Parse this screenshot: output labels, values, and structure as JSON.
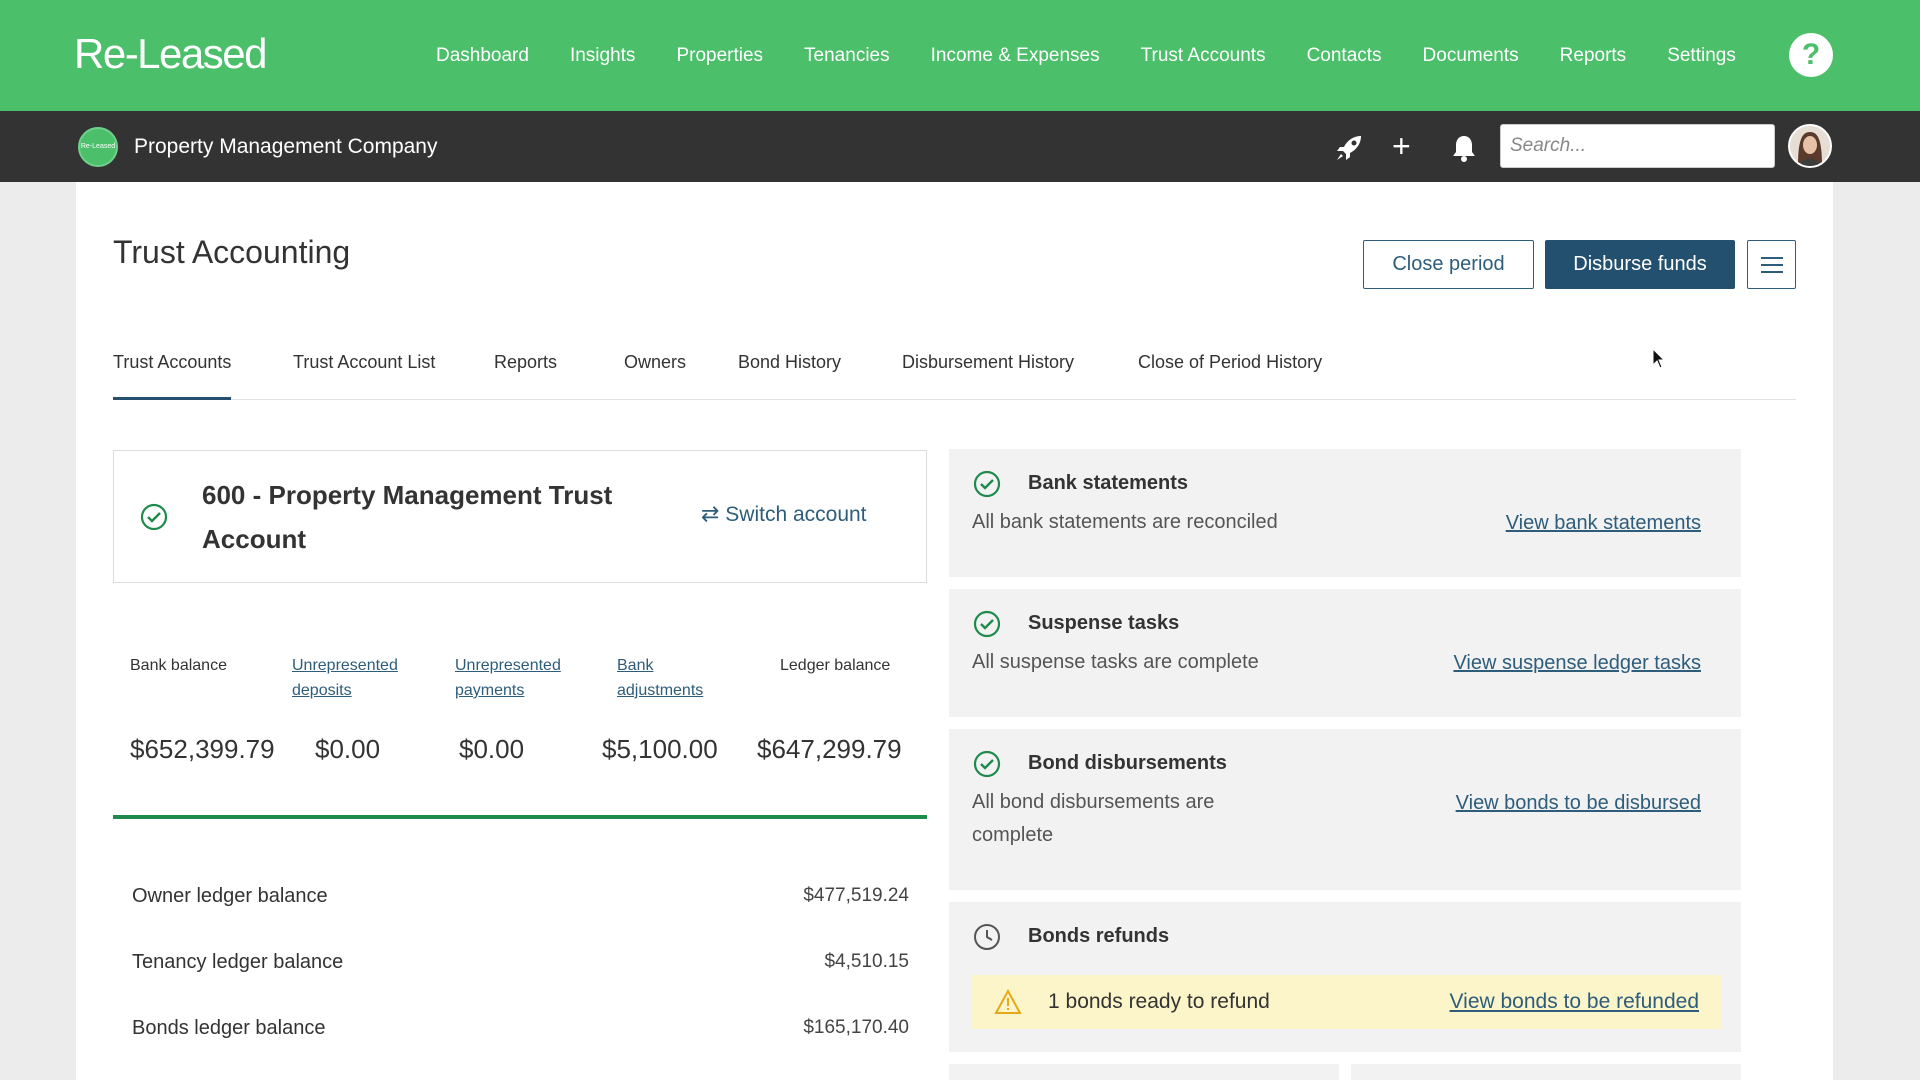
{
  "app": {
    "logo": "Re-Leased",
    "nav": [
      "Dashboard",
      "Insights",
      "Properties",
      "Tenancies",
      "Income & Expenses",
      "Trust Accounts",
      "Contacts",
      "Documents",
      "Reports",
      "Settings"
    ],
    "help": "?"
  },
  "subbar": {
    "company_logo_text": "Re-Leased",
    "company_name": "Property Management Company",
    "search_placeholder": "Search..."
  },
  "page": {
    "title": "Trust Accounting",
    "close_period_label": "Close period",
    "disburse_label": "Disburse funds",
    "tabs": [
      "Trust Accounts",
      "Trust Account List",
      "Reports",
      "Owners",
      "Bond History",
      "Disbursement History",
      "Close of Period History"
    ],
    "active_tab": "Trust Accounts"
  },
  "account": {
    "name": "600 - Property Management Trust Account",
    "switch_label": "Switch account",
    "balances": [
      {
        "label": "Bank balance",
        "value": "$652,399.79",
        "link": false
      },
      {
        "label": "Unrepresented deposits",
        "value": "$0.00",
        "link": true
      },
      {
        "label": "Unrepresented payments",
        "value": "$0.00",
        "link": true
      },
      {
        "label": "Bank adjustments",
        "value": "$5,100.00",
        "link": true
      },
      {
        "label": "Ledger balance",
        "value": "$647,299.79",
        "link": false
      }
    ],
    "ledgers": [
      {
        "label": "Owner ledger balance",
        "value": "$477,519.24"
      },
      {
        "label": "Tenancy ledger balance",
        "value": "$4,510.15"
      },
      {
        "label": "Bonds ledger balance",
        "value": "$165,170.40"
      }
    ]
  },
  "panels": [
    {
      "title": "Bank statements",
      "text": "All bank statements are reconciled",
      "link": "View bank statements",
      "status": "complete"
    },
    {
      "title": "Suspense tasks",
      "text": "All suspense tasks are complete",
      "link": "View suspense ledger tasks",
      "status": "complete"
    },
    {
      "title": "Bond disbursements",
      "text_line1": "All bond disbursements are",
      "text_line2": "complete",
      "link": "View bonds to be disbursed",
      "status": "complete"
    },
    {
      "title": "Bonds refunds",
      "warning": "1 bonds ready to refund",
      "link": "View bonds to be refunded",
      "status": "pending"
    }
  ],
  "colors": {
    "brand_green": "#4cbf6b",
    "dark_bar": "#333333",
    "primary_blue": "#23506e",
    "success_green": "#1e8a4c",
    "warning_yellow": "#fcf5c9"
  }
}
